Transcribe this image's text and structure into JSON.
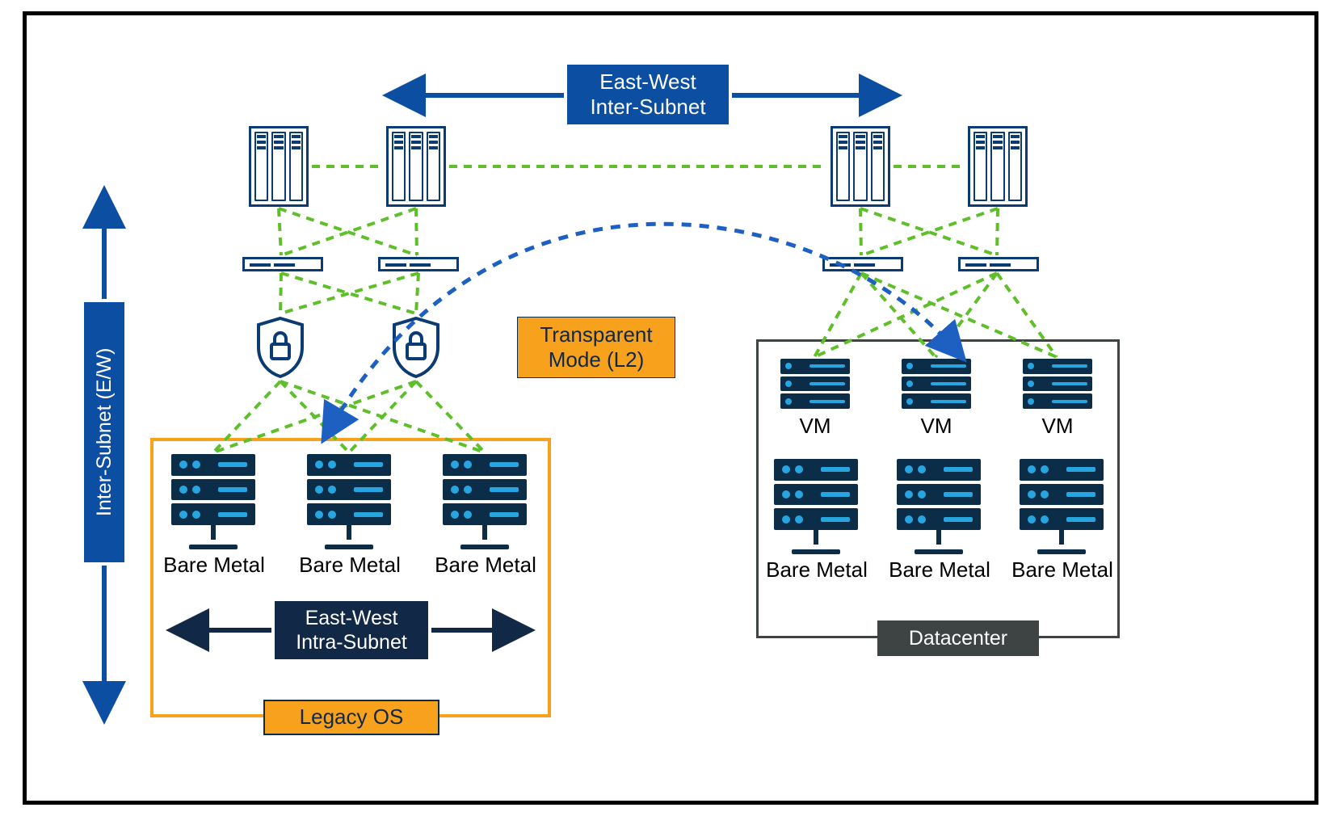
{
  "labels": {
    "east_west_inter": "East-West\nInter-Subnet",
    "east_west_intra": "East-West\nIntra-Subnet",
    "inter_subnet_ew": "Inter-Subnet (E/W)",
    "transparent_mode": "Transparent\nMode (L2)",
    "legacy_os": "Legacy OS",
    "datacenter": "Datacenter"
  },
  "captions": {
    "bare_metal": "Bare Metal",
    "vm": "VM"
  },
  "colors": {
    "blue": "#0b4ea2",
    "dark_blue": "#112846",
    "orange": "#f7a11d",
    "grey": "#3e4344",
    "accent": "#27a5e0",
    "link_green": "#5fbf2a",
    "link_blue": "#1e60c2"
  },
  "topology": {
    "spines": [
      {
        "id": "spine-l1",
        "group": "left"
      },
      {
        "id": "spine-l2",
        "group": "left"
      },
      {
        "id": "spine-r1",
        "group": "right"
      },
      {
        "id": "spine-r2",
        "group": "right"
      }
    ],
    "leaves": [
      {
        "id": "leaf-l1",
        "group": "left"
      },
      {
        "id": "leaf-l2",
        "group": "left"
      },
      {
        "id": "leaf-r1",
        "group": "right"
      },
      {
        "id": "leaf-r2",
        "group": "right"
      }
    ],
    "firewalls": [
      {
        "id": "fw-1"
      },
      {
        "id": "fw-2"
      }
    ],
    "legacy_servers": [
      "bm-l1",
      "bm-l2",
      "bm-l3"
    ],
    "dc_vms": [
      "vm-1",
      "vm-2",
      "vm-3"
    ],
    "dc_baremetal": [
      "bm-r1",
      "bm-r2",
      "bm-r3"
    ],
    "green_links": "spines↔leaves crossbar each side; leaves→firewalls; firewalls→legacy servers (left); leaves→VMs & bare metal (right)",
    "blue_flow": "dashed curved path from left firewall area to right datacenter, arrowheads both ends"
  }
}
